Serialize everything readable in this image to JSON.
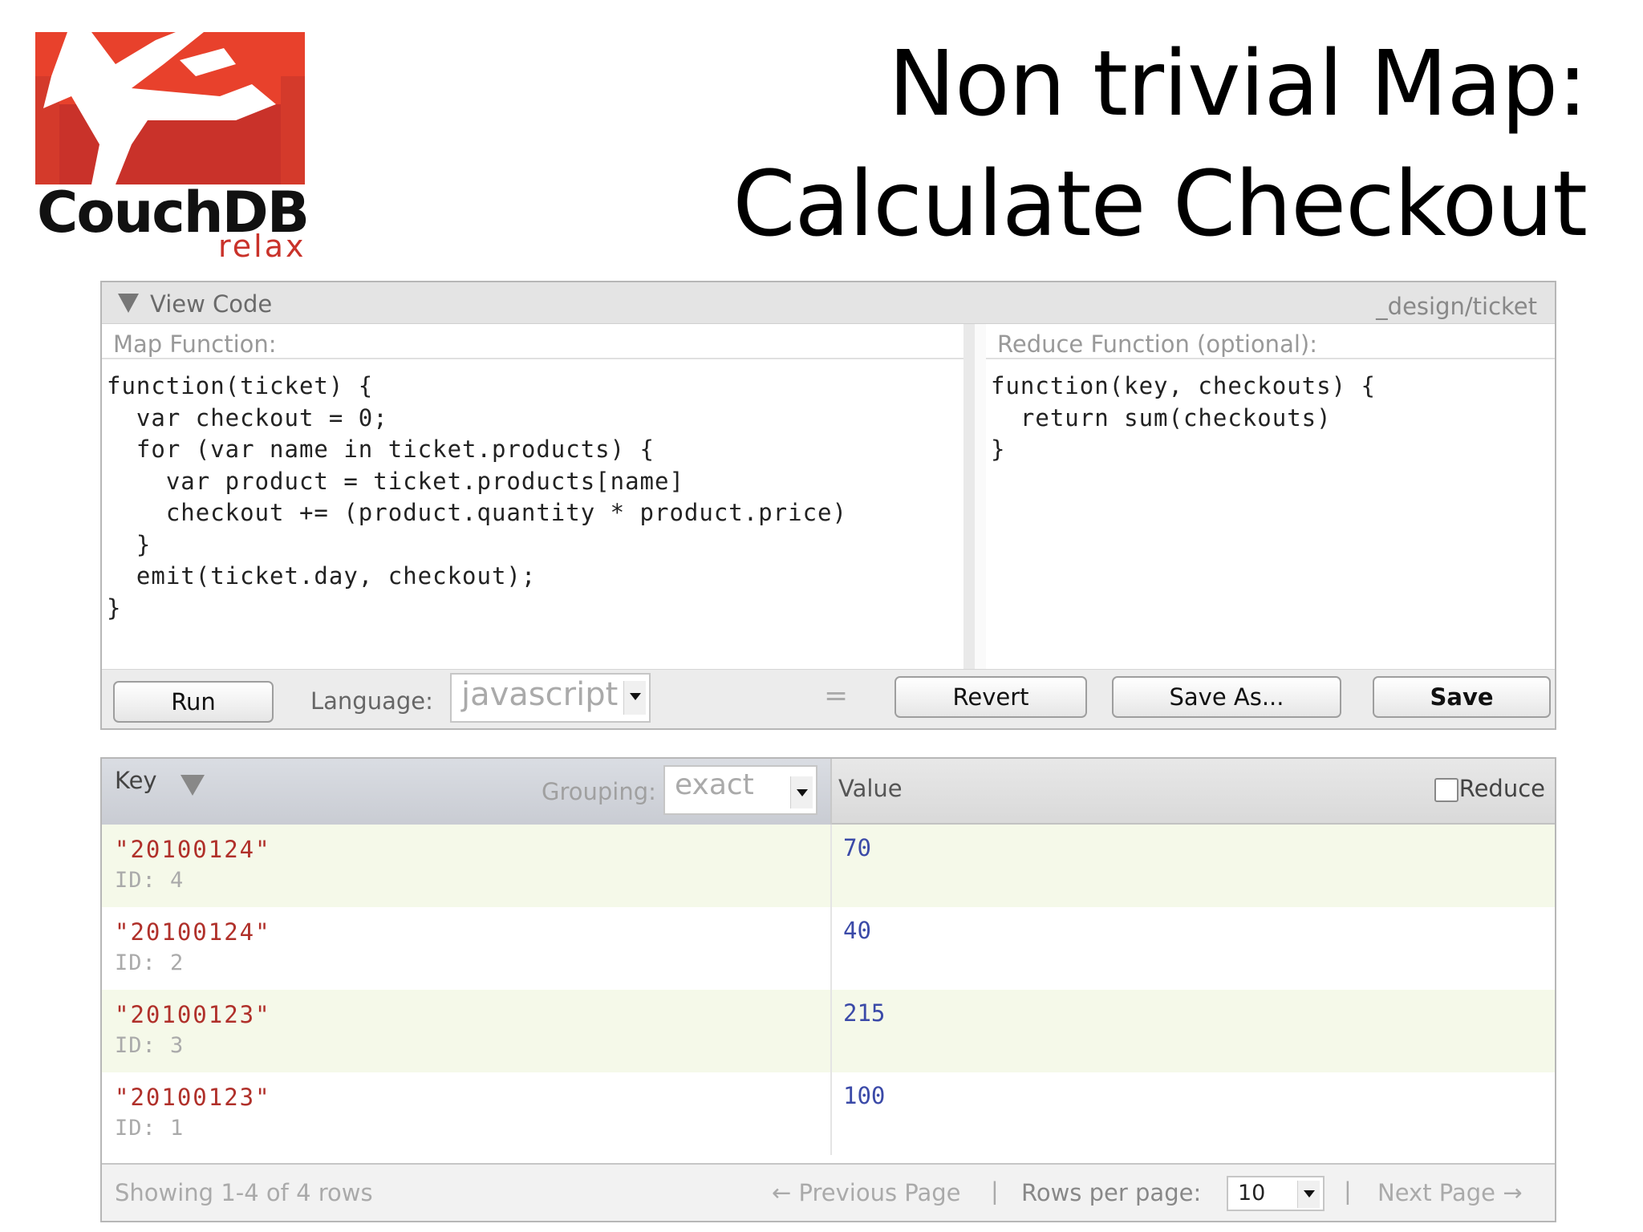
{
  "logo": {
    "word": "CouchDB",
    "tagline": "relax"
  },
  "slide": {
    "title_line1": "Non trivial Map:",
    "title_line2": "Calculate Checkout"
  },
  "panel": {
    "header_title": "View Code",
    "design_doc": "_design/ticket",
    "map_label": "Map Function:",
    "map_code": "function(ticket) {\n  var checkout = 0;\n  for (var name in ticket.products) {\n    var product = ticket.products[name]\n    checkout += (product.quantity * product.price)\n  }\n  emit(ticket.day, checkout);\n}",
    "reduce_label": "Reduce Function (optional):",
    "reduce_code": "function(key, checkouts) {\n  return sum(checkouts)\n}",
    "run_label": "Run",
    "language_label": "Language:",
    "language_value": "javascript",
    "equals": "=",
    "revert_label": "Revert",
    "save_as_label": "Save As...",
    "save_label": "Save"
  },
  "results": {
    "key_header": "Key",
    "grouping_label": "Grouping:",
    "grouping_value": "exact",
    "value_header": "Value",
    "reduce_label": "Reduce",
    "reduce_checked": false,
    "rows": [
      {
        "key": "\"20100124\"",
        "id": "ID: 4",
        "value": "70"
      },
      {
        "key": "\"20100124\"",
        "id": "ID: 2",
        "value": "40"
      },
      {
        "key": "\"20100123\"",
        "id": "ID: 3",
        "value": "215"
      },
      {
        "key": "\"20100123\"",
        "id": "ID: 1",
        "value": "100"
      }
    ],
    "showing": "Showing 1-4 of 4 rows",
    "prev_page": "← Previous Page",
    "separator": "|",
    "rows_per_page_label": "Rows per page:",
    "rows_per_page_value": "10",
    "next_page": "Next Page →"
  },
  "colors": {
    "brand_red": "#e8412c",
    "key_red": "#b0302a",
    "value_blue": "#3b4aa8",
    "row_alt": "#f5f9e9"
  }
}
